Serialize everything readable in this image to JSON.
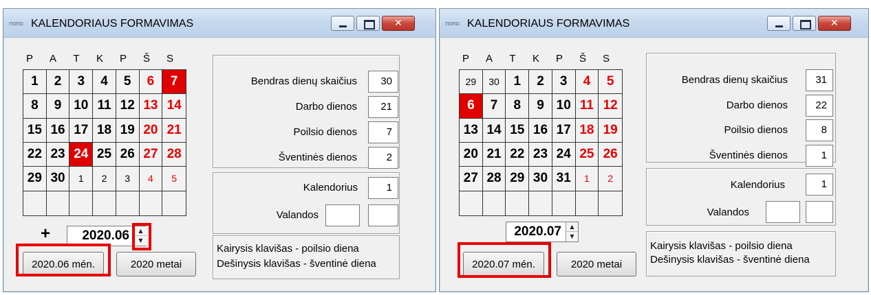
{
  "windows": [
    {
      "app_icon": "nono",
      "title": "KALENDORIAUS FORMAVIMAS",
      "weekdays": [
        "P",
        "A",
        "T",
        "K",
        "P",
        "Š",
        "S"
      ],
      "calendar": [
        [
          {
            "t": "1"
          },
          {
            "t": "2"
          },
          {
            "t": "3"
          },
          {
            "t": "4"
          },
          {
            "t": "5"
          },
          {
            "t": "6",
            "c": "red"
          },
          {
            "t": "7",
            "c": "hl"
          }
        ],
        [
          {
            "t": "8"
          },
          {
            "t": "9"
          },
          {
            "t": "10"
          },
          {
            "t": "11"
          },
          {
            "t": "12"
          },
          {
            "t": "13",
            "c": "red"
          },
          {
            "t": "14",
            "c": "red"
          }
        ],
        [
          {
            "t": "15"
          },
          {
            "t": "16"
          },
          {
            "t": "17"
          },
          {
            "t": "18"
          },
          {
            "t": "19"
          },
          {
            "t": "20",
            "c": "red"
          },
          {
            "t": "21",
            "c": "red"
          }
        ],
        [
          {
            "t": "22"
          },
          {
            "t": "23"
          },
          {
            "t": "24",
            "c": "hl"
          },
          {
            "t": "25"
          },
          {
            "t": "26"
          },
          {
            "t": "27",
            "c": "red"
          },
          {
            "t": "28",
            "c": "red"
          }
        ],
        [
          {
            "t": "29"
          },
          {
            "t": "30"
          },
          {
            "t": "1",
            "c": "small"
          },
          {
            "t": "2",
            "c": "small"
          },
          {
            "t": "3",
            "c": "small"
          },
          {
            "t": "4",
            "c": "small red"
          },
          {
            "t": "5",
            "c": "small red"
          }
        ],
        [
          {
            "t": ""
          },
          {
            "t": ""
          },
          {
            "t": ""
          },
          {
            "t": ""
          },
          {
            "t": ""
          },
          {
            "t": ""
          },
          {
            "t": ""
          }
        ]
      ],
      "stats": [
        {
          "label": "Bendras dienų skaičius",
          "value": "30"
        },
        {
          "label": "Darbo dienos",
          "value": "21"
        },
        {
          "label": "Poilsio dienos",
          "value": "7"
        },
        {
          "label": "Šventinės dienos",
          "value": "2"
        }
      ],
      "kalendorius_label": "Kalendorius",
      "kalendorius_value": "1",
      "valandos_label": "Valandos",
      "valandos_value1": "",
      "valandos_value2": "",
      "plus": "+",
      "period": "2020.06",
      "month_button": "2020.06 mén.",
      "year_button": "2020 metai",
      "hint_line1": "Kairysis klavišas - poilsio diena",
      "hint_line2": "Dešinysis klavišas - šventinė diena"
    },
    {
      "app_icon": "nono",
      "title": "KALENDORIAUS FORMAVIMAS",
      "weekdays": [
        "P",
        "A",
        "T",
        "K",
        "P",
        "Š",
        "S"
      ],
      "calendar": [
        [
          {
            "t": "29",
            "c": "small"
          },
          {
            "t": "30",
            "c": "small"
          },
          {
            "t": "1"
          },
          {
            "t": "2"
          },
          {
            "t": "3"
          },
          {
            "t": "4",
            "c": "red"
          },
          {
            "t": "5",
            "c": "red"
          }
        ],
        [
          {
            "t": "6",
            "c": "hl"
          },
          {
            "t": "7"
          },
          {
            "t": "8"
          },
          {
            "t": "9"
          },
          {
            "t": "10"
          },
          {
            "t": "11",
            "c": "red"
          },
          {
            "t": "12",
            "c": "red"
          }
        ],
        [
          {
            "t": "13"
          },
          {
            "t": "14"
          },
          {
            "t": "15"
          },
          {
            "t": "16"
          },
          {
            "t": "17"
          },
          {
            "t": "18",
            "c": "red"
          },
          {
            "t": "19",
            "c": "red"
          }
        ],
        [
          {
            "t": "20"
          },
          {
            "t": "21"
          },
          {
            "t": "22"
          },
          {
            "t": "23"
          },
          {
            "t": "24"
          },
          {
            "t": "25",
            "c": "red"
          },
          {
            "t": "26",
            "c": "red"
          }
        ],
        [
          {
            "t": "27"
          },
          {
            "t": "28"
          },
          {
            "t": "29"
          },
          {
            "t": "30"
          },
          {
            "t": "31"
          },
          {
            "t": "1",
            "c": "small red"
          },
          {
            "t": "2",
            "c": "small red"
          }
        ],
        [
          {
            "t": ""
          },
          {
            "t": ""
          },
          {
            "t": ""
          },
          {
            "t": ""
          },
          {
            "t": ""
          },
          {
            "t": ""
          },
          {
            "t": ""
          }
        ]
      ],
      "stats": [
        {
          "label": "Bendras dienų skaičius",
          "value": "31"
        },
        {
          "label": "Darbo dienos",
          "value": "22"
        },
        {
          "label": "Poilsio dienos",
          "value": "8"
        },
        {
          "label": "Šventinės dienos",
          "value": "1"
        }
      ],
      "kalendorius_label": "Kalendorius",
      "kalendorius_value": "1",
      "valandos_label": "Valandos",
      "valandos_value1": "",
      "valandos_value2": "",
      "plus": "",
      "period": "2020.07",
      "month_button": "2020.07 mén.",
      "year_button": "2020 metai",
      "hint_line1": "Kairysis klavišas - poilsio diena",
      "hint_line2": "Dešinysis klavišas - šventinė diena"
    }
  ],
  "colors": {
    "holiday_red": "#e80000",
    "highlight_bg": "#e00000",
    "annotation_red": "#e80000",
    "titlebar": "#c3d6ec"
  }
}
